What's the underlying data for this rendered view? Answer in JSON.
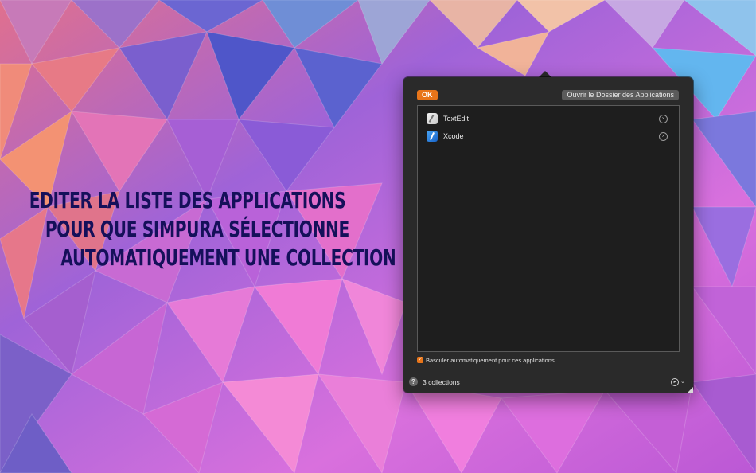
{
  "headline": {
    "line1": "EDITER LA LISTE DES APPLICATIONS",
    "line2": "POUR QUE SIMPURA SÉLECTIONNE",
    "line3": "AUTOMATIQUEMENT UNE COLLECTION"
  },
  "popover": {
    "ok_label": "OK",
    "open_folder_label": "Ouvrir le Dossier des Applications",
    "apps": [
      {
        "name": "TextEdit",
        "icon": "textedit-app-icon",
        "remove_icon": "remove-circle-icon"
      },
      {
        "name": "Xcode",
        "icon": "xcode-app-icon",
        "remove_icon": "remove-circle-icon"
      }
    ],
    "auto_switch_label": "Basculer automatiquement pour ces applications",
    "auto_switch_checked": true,
    "help_label": "?",
    "collections_count": "3 collections",
    "action_icon": "action-menu-icon"
  },
  "colors": {
    "accent": "#e8751a",
    "headline": "#15105a",
    "panel_bg": "#2a2a2a"
  }
}
